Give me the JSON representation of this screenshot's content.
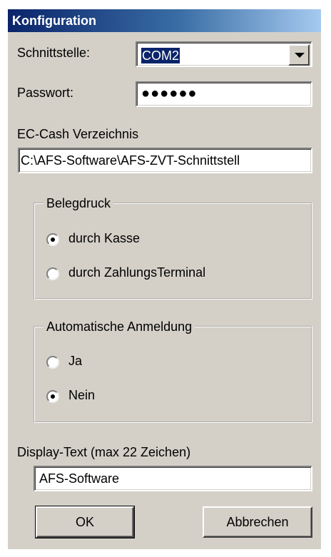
{
  "window": {
    "title": "Konfiguration"
  },
  "interface": {
    "label": "Schnittstelle:",
    "selected": "COM2"
  },
  "password": {
    "label": "Passwort:",
    "masked_value": "●●●●●●"
  },
  "ec_cash": {
    "label": "EC-Cash Verzeichnis",
    "path": "C:\\AFS-Software\\AFS-ZVT-Schnittstell"
  },
  "receipt_print": {
    "legend": "Belegdruck",
    "options": [
      {
        "label": "durch Kasse",
        "selected": true
      },
      {
        "label": "durch ZahlungsTerminal",
        "selected": false
      }
    ]
  },
  "auto_login": {
    "legend": "Automatische Anmeldung",
    "options": [
      {
        "label": "Ja",
        "selected": false
      },
      {
        "label": "Nein",
        "selected": true
      }
    ]
  },
  "display_text": {
    "label": "Display-Text (max 22 Zeichen)",
    "value": "AFS-Software"
  },
  "buttons": {
    "ok": "OK",
    "cancel": "Abbrechen"
  },
  "colors": {
    "dialog_bg": "#d4d0c8",
    "title_start": "#0a246a",
    "title_end": "#a6caf0",
    "selection": "#0a246a"
  }
}
